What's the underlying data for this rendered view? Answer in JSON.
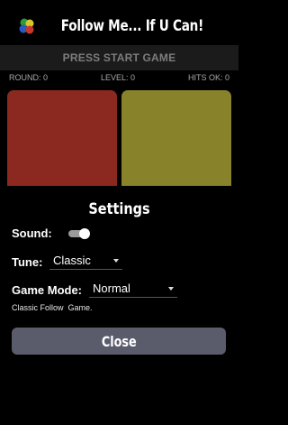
{
  "app": {
    "title": "Follow Me... If U Can!"
  },
  "start_bar": {
    "label": "PRESS START GAME"
  },
  "stats": {
    "round": "ROUND: 0",
    "level": "LEVEL: 0",
    "hits": "HITS OK: 0"
  },
  "pads": [
    {
      "color": "#8b2820"
    },
    {
      "color": "#88822a"
    }
  ],
  "settings": {
    "title": "Settings",
    "sound": {
      "label": "Sound:",
      "enabled": true
    },
    "tune": {
      "label": "Tune:",
      "value": "Classic"
    },
    "game_mode": {
      "label": "Game Mode:",
      "value": "Normal"
    },
    "description": "Classic Follow  Game.",
    "close_label": "Close"
  },
  "colors": {
    "close_button": "#5b5c6b",
    "toggle_on": "#9a9a9a"
  }
}
